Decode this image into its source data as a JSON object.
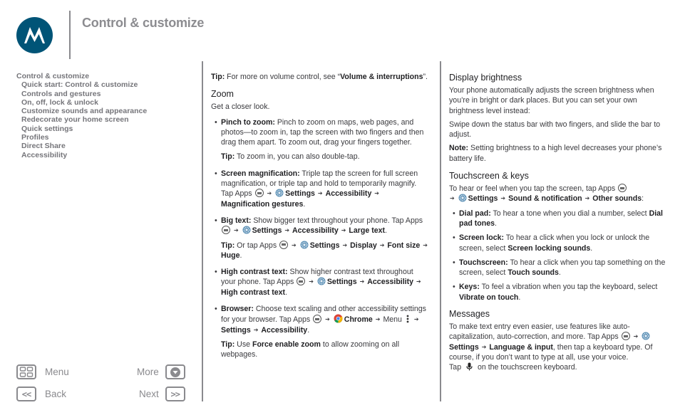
{
  "header": {
    "logo": "motorola-logo",
    "chapter_title": "Control & customize"
  },
  "toc": {
    "items": [
      {
        "label": "Control & customize",
        "level": 0
      },
      {
        "label": "Quick start: Control & customize",
        "level": 1
      },
      {
        "label": "Controls and gestures",
        "level": 1
      },
      {
        "label": "On, off, lock & unlock",
        "level": 1
      },
      {
        "label": "Customize sounds and appearance",
        "level": 1
      },
      {
        "label": "Redecorate your home screen",
        "level": 1
      },
      {
        "label": "Quick settings",
        "level": 1
      },
      {
        "label": "Profiles",
        "level": 1
      },
      {
        "label": "Direct Share",
        "level": 1
      },
      {
        "label": "Accessibility",
        "level": 1
      }
    ]
  },
  "nav": {
    "menu": "Menu",
    "more": "More",
    "back": "Back",
    "next": "Next",
    "back_glyph": "<<",
    "next_glyph": ">>"
  },
  "colors": {
    "brand": "#005477",
    "muted": "#8a8a8e",
    "text": "#3a3a3e"
  },
  "middle": {
    "tip1": {
      "label": "Tip:",
      "text": " For more on volume control, see “",
      "link": "Volume & interruptions",
      "end": "”."
    },
    "zoom_heading": "Zoom",
    "zoom_intro": "Get a closer look.",
    "pinch": {
      "label": "Pinch to zoom:",
      "text": " Pinch to zoom on maps, web pages, and photos—to zoom in, tap the screen with two fingers and then drag them apart. To zoom out, drag your fingers together."
    },
    "tip2": {
      "label": "Tip:",
      "text": " To zoom in, you can also double-tap."
    },
    "magnification": {
      "label": "Screen magnification:",
      "text": " Triple tap the screen for full screen magnification, or triple tap and hold to temporarily magnify. Tap Apps",
      "settings": "Settings",
      "accessibility": "Accessibility",
      "target": "Magnification gestures",
      "end": "."
    },
    "bigtext": {
      "label": "Big text:",
      "text": " Show bigger text throughout your phone. Tap Apps",
      "settings": "Settings",
      "accessibility": "Accessibility",
      "target": "Large text",
      "end": "."
    },
    "tip3": {
      "label": "Tip:",
      "text": " Or tap Apps",
      "settings": "Settings",
      "display": "Display",
      "fontsize": "Font size",
      "huge": "Huge",
      "end": "."
    },
    "highcontrast": {
      "label": "High contrast text:",
      "text": " Show higher contrast text throughout your phone. Tap Apps",
      "settings": "Settings",
      "accessibility": "Accessibility",
      "target": "High contrast text",
      "end": "."
    },
    "browser": {
      "label": "Browser:",
      "text": " Choose text scaling and other accessibility settings for your browser. Tap Apps",
      "chrome": "Chrome",
      "menu": "Menu",
      "settings": "Settings",
      "accessibility": "Accessibility",
      "end": "."
    },
    "tip4": {
      "label": "Tip:",
      "pre": " Use ",
      "option": "Force enable zoom",
      "text": " to allow zooming on all webpages."
    }
  },
  "right": {
    "brightness_heading": "Display brightness",
    "brightness_p1": "Your phone automatically adjusts the screen brightness when you’re in bright or dark places. But you can set your own brightness level instead:",
    "brightness_p2": "Swipe down the status bar with two fingers, and slide the bar to adjust.",
    "note": {
      "label": "Note:",
      "text": " Setting brightness to a high level decreases your phone’s battery life."
    },
    "touch_heading": "Touchscreen & keys",
    "touch_intro": {
      "text": "To hear or feel when you tap the screen, tap Apps",
      "settings": "Settings",
      "sound": "Sound & notification",
      "other": "Other sounds",
      "end": ":"
    },
    "dialpad": {
      "label": "Dial pad:",
      "text": " To hear a tone when you dial a number, select ",
      "option": "Dial pad tones",
      "end": "."
    },
    "screenlock": {
      "label": "Screen lock:",
      "text": " To hear a click when you lock or unlock the screen, select ",
      "option": "Screen locking sounds",
      "end": "."
    },
    "touchscreen": {
      "label": "Touchscreen:",
      "text": " To hear a click when you tap something on the screen, select ",
      "option": "Touch sounds",
      "end": "."
    },
    "keys": {
      "label": "Keys:",
      "text": " To feel a vibration when you tap the keyboard, select ",
      "option": "Vibrate on touch",
      "end": "."
    },
    "messages_heading": "Messages",
    "messages": {
      "text": "To make text entry even easier, use features like auto-capitalization, auto-correction, and more. Tap Apps",
      "settings": "Settings",
      "language": "Language & input",
      "text2": ", then tap a keyboard type. Of course, if you don’t want to type at all, use your voice.",
      "tap": "Tap",
      "text3": " on the touchscreen keyboard."
    }
  }
}
